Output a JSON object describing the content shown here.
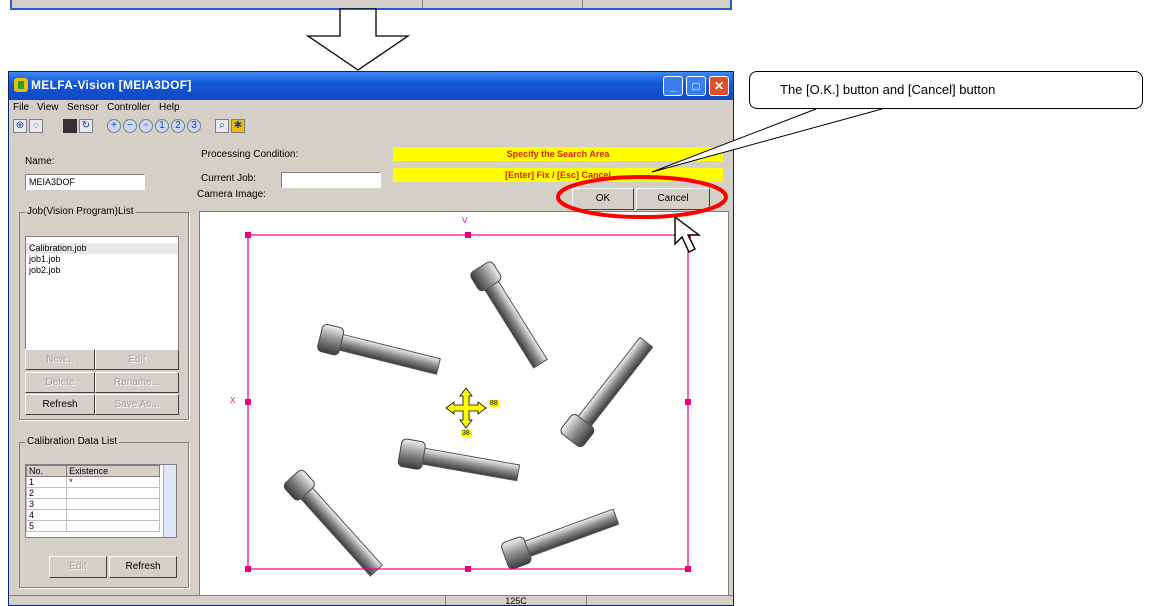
{
  "top_remnant": {
    "cells": [
      "",
      ""
    ]
  },
  "window": {
    "title": "MELFA-Vision [MEIA3DOF]",
    "menu": [
      "File",
      "View",
      "Sensor",
      "Controller",
      "Help"
    ],
    "name_label": "Name:",
    "name_value": "MEIA3DOF",
    "processing_label": "Processing Condition:",
    "current_job_label": "Current Job:",
    "current_job_value": "",
    "camera_image_label": "Camera Image:",
    "status_line1": "Specify the Search Area",
    "status_line2": "[Enter] Fix / [Esc] Cancel",
    "ok_label": "OK",
    "cancel_label": "Cancel",
    "job_list_title": "Job(Vision Program)List",
    "jobs": [
      "Calibration.job",
      "job1.job",
      "job2.job"
    ],
    "job_buttons": {
      "new": "New...",
      "edit": "Edit",
      "delete": "Delete",
      "rename": "Rename...",
      "refresh": "Refresh",
      "save_as": "Save As..."
    },
    "calibration_title": "Calibration Data List",
    "calibration_columns": [
      "No.",
      "Existence"
    ],
    "calibration_rows": [
      [
        "1",
        "*"
      ],
      [
        "2",
        ""
      ],
      [
        "3",
        ""
      ],
      [
        "4",
        ""
      ],
      [
        "5",
        ""
      ]
    ],
    "cal_buttons": {
      "edit": "Edit",
      "refresh": "Refresh"
    },
    "search_area": {
      "top_marker": "V",
      "left_marker": "X",
      "center_label_x": "88",
      "center_label_y": "38"
    },
    "status_bar": "125C"
  },
  "callout": {
    "text": "The [O.K.] button and [Cancel] button"
  },
  "colors": {
    "title_bar": "#1556d6",
    "search_frame": "#e6007e",
    "status_bg": "#ffff00",
    "status_text": "#e02000",
    "highlight": "#ff0000"
  }
}
